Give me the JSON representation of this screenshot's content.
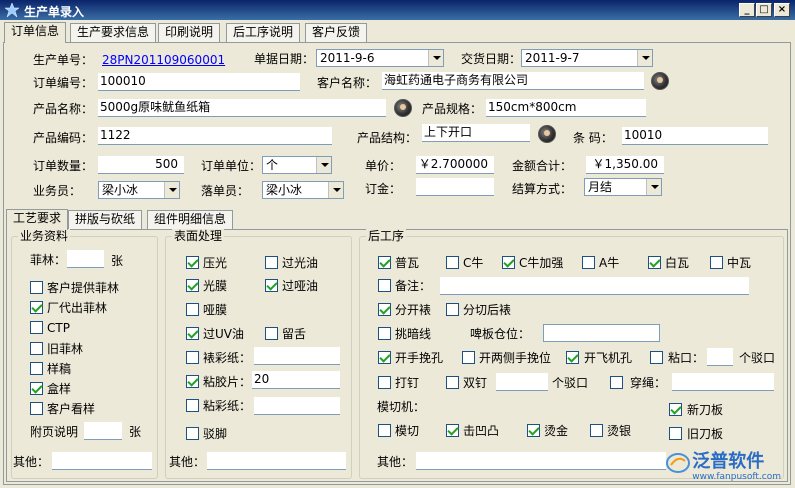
{
  "window": {
    "title": "生产单录入",
    "min": "_",
    "max": "□",
    "close": "×"
  },
  "tabs": [
    "订单信息",
    "生产要求信息",
    "印刷说明",
    "后工序说明",
    "客户反馈"
  ],
  "order": {
    "order_no_label": "生产单号：",
    "order_no": "28PN201109060001",
    "doc_date_label": "单据日期：",
    "doc_date": "2011-9-6",
    "delivery_date_label": "交货日期：",
    "delivery_date": "2011-9-7",
    "order_code_label": "订单编号：",
    "order_code": "100010",
    "customer_label": "客户名称：",
    "customer": "海虹药通电子商务有限公司",
    "product_name_label": "产品名称：",
    "product_name": "5000g原味鱿鱼纸箱",
    "spec_label": "产品规格：",
    "spec": "150cm*800cm",
    "product_code_label": "产品编码：",
    "product_code": "1122",
    "structure_label": "产品结构：",
    "structure": "上下开口",
    "barcode_label": "条 码：",
    "barcode": "10010",
    "qty_label": "订单数量：",
    "qty": "500",
    "unit_label": "订单单位：",
    "unit": "个",
    "price_label": "单价：",
    "price": "￥2.700000",
    "total_label": "金额合计：",
    "total": "￥1,350.00",
    "sales_label": "业务员：",
    "sales": "梁小冰",
    "maker_label": "落单员：",
    "maker": "梁小冰",
    "deposit_label": "订金：",
    "deposit": "",
    "payment_label": "结算方式：",
    "payment": "月结"
  },
  "subtabs": [
    "工艺要求",
    "拼版与砍纸",
    "组件明细信息"
  ],
  "business": {
    "title": "业务资料",
    "feilin_label": "菲林：",
    "feilin_unit": "张",
    "items": [
      {
        "label": "客户提供菲林",
        "checked": false
      },
      {
        "label": "厂代出菲林",
        "checked": true
      },
      {
        "label": "CTP",
        "checked": false
      },
      {
        "label": "旧菲林",
        "checked": false
      },
      {
        "label": "样稿",
        "checked": false
      },
      {
        "label": "盒样",
        "checked": true
      },
      {
        "label": "客户看样",
        "checked": false
      }
    ],
    "attach_label": "附页说明",
    "attach_unit": "张",
    "other_label": "其他："
  },
  "surface": {
    "title": "表面处理",
    "left": [
      {
        "label": "压光",
        "checked": true
      },
      {
        "label": "光膜",
        "checked": true
      },
      {
        "label": "哑膜",
        "checked": false
      },
      {
        "label": "过UV油",
        "checked": true
      },
      {
        "label": "裱彩纸：",
        "checked": false
      },
      {
        "label": "粘胶片：",
        "checked": true,
        "value": "20"
      },
      {
        "label": "粘彩纸：",
        "checked": false
      },
      {
        "label": "驳脚",
        "checked": false
      }
    ],
    "right": [
      {
        "label": "过光油",
        "checked": false
      },
      {
        "label": "过哑油",
        "checked": true
      },
      {
        "label": "留舌",
        "checked": false
      }
    ],
    "other_label": "其他："
  },
  "post": {
    "title": "后工序",
    "row1": [
      {
        "label": "普瓦",
        "checked": true
      },
      {
        "label": "C牛",
        "checked": false
      },
      {
        "label": "C牛加强",
        "checked": true
      },
      {
        "label": "A牛",
        "checked": false
      },
      {
        "label": "白瓦",
        "checked": true
      },
      {
        "label": "中瓦",
        "checked": false
      }
    ],
    "remark_label": "备注：",
    "split_label": "分开裱",
    "split_after_label": "分切后裱",
    "crease_label": "挑暗线",
    "beer_label": "啤板仓位：",
    "handle_label": "开手挽孔",
    "both_side_label": "开两侧手挽位",
    "plane_label": "开飞机孔",
    "glue_label": "粘口：",
    "glue_unit": "个驳口",
    "nail_label": "打钉",
    "double_nail_label": "双钉",
    "nail_unit": "个驳口",
    "rope_label": "穿绳：",
    "die_label": "模切机：",
    "new_knife_label": "新刀板",
    "old_knife_label": "旧刀板",
    "diecut_label": "模切",
    "emboss_label": "击凹凸",
    "gold_label": "烫金",
    "silver_label": "烫银",
    "other_label": "其他："
  },
  "watermark": {
    "brand": "泛普软件",
    "url": "www.fanpusoft.com"
  }
}
